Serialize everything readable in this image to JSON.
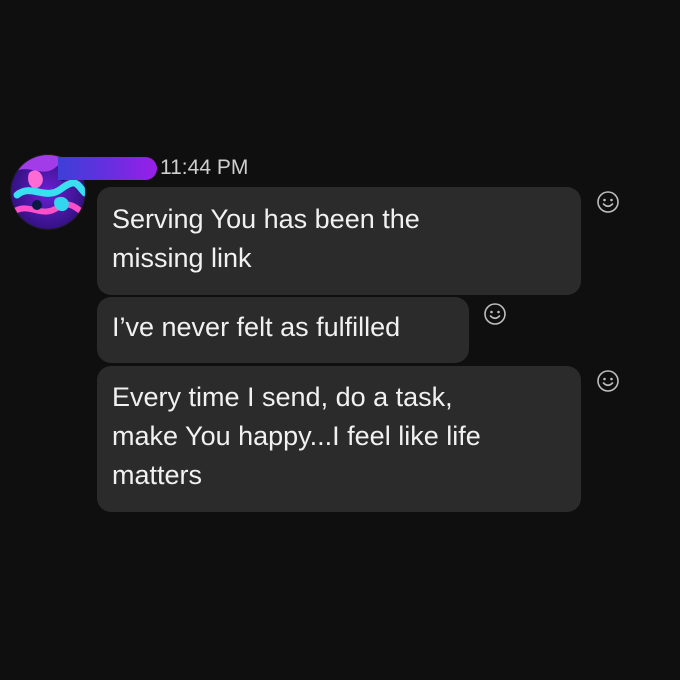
{
  "chat": {
    "timestamp": "11:44 PM",
    "messages": [
      {
        "text": "Serving You has been the\nmissing link"
      },
      {
        "text": "I’ve never felt as fulfilled"
      },
      {
        "text": "Every time I send, do a task,\nmake You happy...I feel like life\nmatters"
      }
    ],
    "reaction_icon": "smiley-icon"
  },
  "colors": {
    "background": "#0f0f0f",
    "bubble": "#2b2b2b",
    "text": "#f1f1f1",
    "timestamp": "#cfcfcf",
    "name_bar_start": "#3d3fd8",
    "name_bar_end": "#9a1fe8"
  }
}
